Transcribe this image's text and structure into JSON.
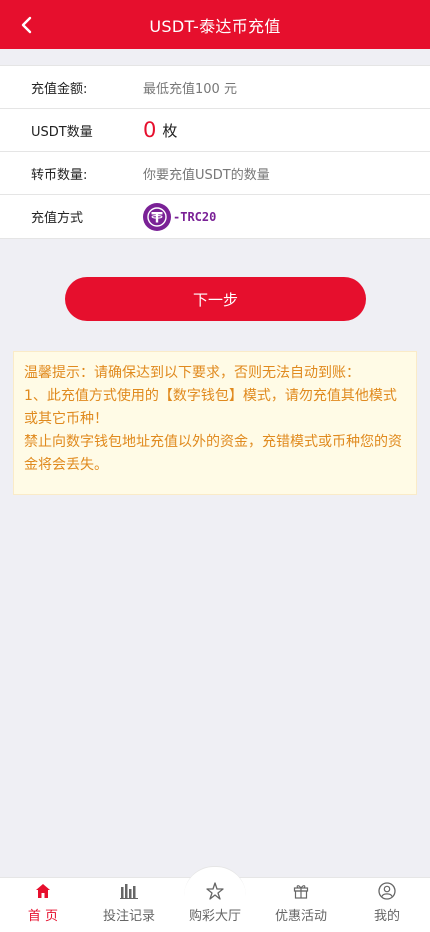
{
  "header": {
    "title": "USDT-泰达币充值"
  },
  "form": {
    "amount_label": "充值金额:",
    "amount_placeholder": "最低充值100 元",
    "usdt_label": "USDT数量",
    "usdt_count": "0",
    "usdt_unit": "枚",
    "coin_label": "转币数量:",
    "coin_placeholder": "你要充值USDT的数量",
    "method_label": "充值方式",
    "method_value": "-TRC20"
  },
  "button": {
    "next_label": "下一步"
  },
  "tips": {
    "line1": "温馨提示：请确保达到以下要求，否则无法自动到账：",
    "line2": "1、此充值方式使用的【数字钱包】模式，请勿充值其他模式或其它币种！",
    "line3": "禁止向数字钱包地址充值以外的资金，充错模式或币种您的资金将会丢失。"
  },
  "tabbar": {
    "items": [
      {
        "label": "首 页",
        "icon": "home-icon"
      },
      {
        "label": "投注记录",
        "icon": "bar-chart-icon"
      },
      {
        "label": "购彩大厅",
        "icon": "star-icon"
      },
      {
        "label": "优惠活动",
        "icon": "gift-icon"
      },
      {
        "label": "我的",
        "icon": "user-icon"
      }
    ]
  },
  "colors": {
    "primary": "#e60f2d",
    "tether": "#7a2196",
    "tip_text": "#e08a1e",
    "tip_bg": "#fffbe6"
  }
}
